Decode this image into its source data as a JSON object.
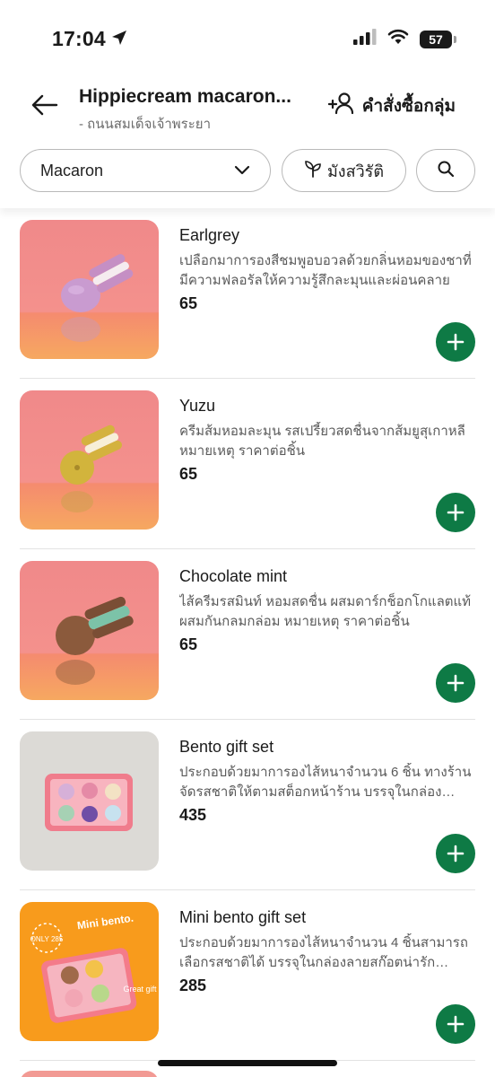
{
  "status_bar": {
    "time": "17:04",
    "battery": "57"
  },
  "header": {
    "store_title": "Hippiecream macaron...",
    "store_subtitle": "- ถนนสมเด็จเจ้าพระยา",
    "group_order_label": "คำสั่งซื้อกลุ่ม"
  },
  "filters": {
    "category_label": "Macaron",
    "vegetarian_label": "มังสวิรัติ"
  },
  "colors": {
    "accent_green": "#0e7a45"
  },
  "products": [
    {
      "name": "Earlgrey",
      "description": "เปลือกมาการองสีชมพูอบอวลด้วยกลิ่นหอมของชาที่มีความฟลอรัลให้ความรู้สึกละมุนและผ่อนคลาย",
      "price": "65"
    },
    {
      "name": "Yuzu",
      "description": "ครีมส้มหอมละมุน รสเปรี้ยวสดชื่นจากส้มยูสุเกาหลี หมายเหตุ ราคาต่อชิ้น",
      "price": "65"
    },
    {
      "name": "Chocolate mint",
      "description": "ไส้ครีมรสมินท์ หอมสดชื่น ผสมดาร์กช็อกโกแลตแท้ ผสมกันกลมกล่อม หมายเหตุ ราคาต่อชิ้น",
      "price": "65"
    },
    {
      "name": "Bento gift set",
      "description": "ประกอบด้วยมาการองไส้หนาจำนวน 6 ชิ้น ทางร้านจัดรสชาติให้ตามสต็อกหน้าร้าน บรรจุในกล่องสวยงาม",
      "price": "435"
    },
    {
      "name": "Mini bento gift set",
      "description": "ประกอบด้วยมาการองไส้หนาจำนวน 4 ชิ้นสามารถเลือกรสชาติได้ บรรจุในกล่องลายสก๊อตน่ารักสามารถ",
      "price": "285",
      "image_text": {
        "badge": "ONLY 285",
        "title": "Mini bento.",
        "tag": "Great gift"
      }
    }
  ]
}
